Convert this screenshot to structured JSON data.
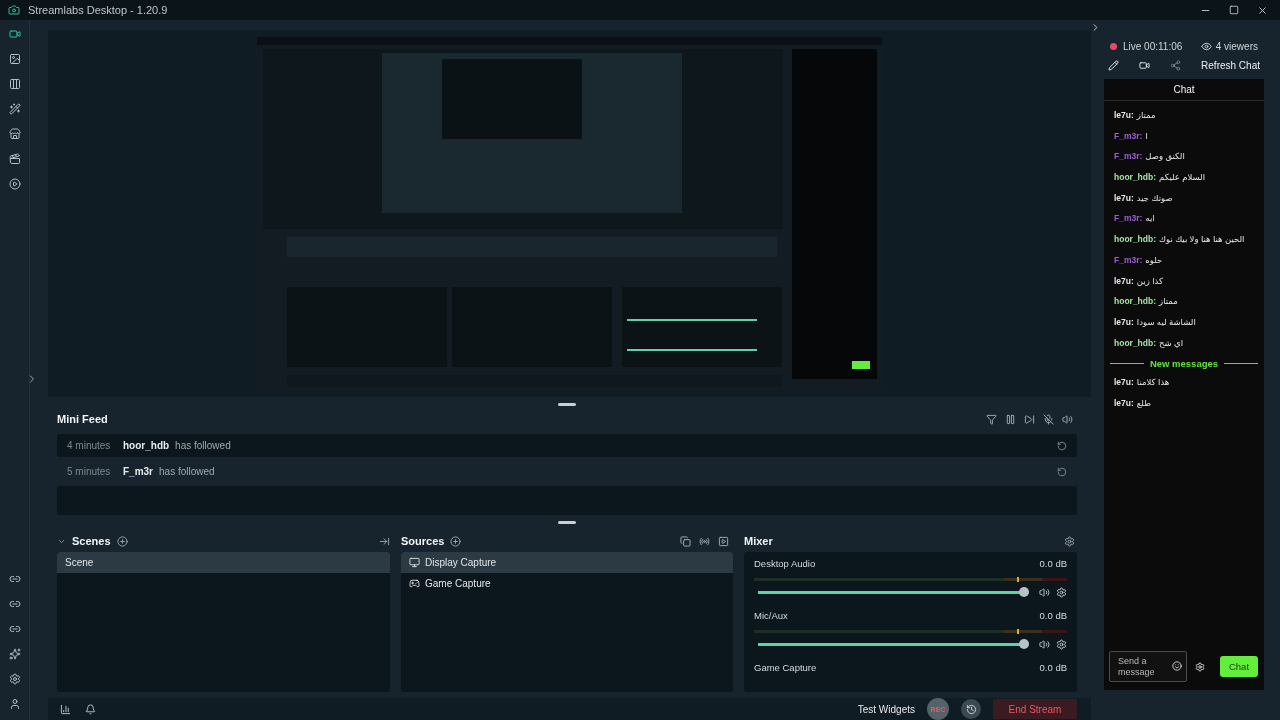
{
  "window": {
    "title": "Streamlabs Desktop - 1.20.9"
  },
  "nav": [
    {
      "selected": true
    },
    {
      "selected": false
    },
    {
      "selected": false
    },
    {
      "selected": false
    },
    {
      "selected": false
    },
    {
      "selected": false
    },
    {
      "selected": false
    }
  ],
  "mini_feed": {
    "title": "Mini Feed",
    "events": [
      {
        "time": "4 minutes",
        "user": "hoor_hdb",
        "action": "has followed"
      },
      {
        "time": "5 minutes",
        "user": "F_m3r",
        "action": "has followed"
      }
    ]
  },
  "scenes": {
    "title": "Scenes",
    "items": [
      {
        "name": "Scene",
        "selected": true
      }
    ]
  },
  "sources": {
    "title": "Sources",
    "items": [
      {
        "name": "Display Capture",
        "kind": "display",
        "selected": true
      },
      {
        "name": "Game Capture",
        "kind": "game",
        "selected": false
      }
    ]
  },
  "mixer": {
    "title": "Mixer",
    "channels": [
      {
        "name": "Desktop Audio",
        "reading": "0.0 dB",
        "level": 0.98
      },
      {
        "name": "Mic/Aux",
        "reading": "0.0 dB",
        "level": 0.98
      },
      {
        "name": "Game Capture",
        "reading": "0.0 dB"
      }
    ]
  },
  "footer": {
    "test_widgets": "Test Widgets",
    "rec": "REC",
    "end_stream": "End Stream"
  },
  "stream": {
    "status": "Live 00:11:06",
    "viewers": "4 viewers",
    "refresh": "Refresh Chat"
  },
  "chat": {
    "title": "Chat",
    "messages": [
      {
        "kind": "message",
        "user": "le7u:",
        "text": "ممتاز",
        "color": "#e8e8e8"
      },
      {
        "kind": "message",
        "user": "F_m3r:",
        "text": "ا",
        "color": "#9a5fd8"
      },
      {
        "kind": "message",
        "user": "F_m3r:",
        "text": "الكنق وصل",
        "color": "#9a5fd8"
      },
      {
        "kind": "message",
        "user": "hoor_hdb:",
        "text": "السلام عليكم",
        "color": "#a3e3a3"
      },
      {
        "kind": "message",
        "user": "le7u:",
        "text": "صوتك جيد",
        "color": "#e8e8e8"
      },
      {
        "kind": "message",
        "user": "F_m3r:",
        "text": "ايه",
        "color": "#9a5fd8"
      },
      {
        "kind": "message",
        "user": "hoor_hdb:",
        "text": "الحين هنا هنا ولا بيك نوك",
        "color": "#a3e3a3"
      },
      {
        "kind": "message",
        "user": "F_m3r:",
        "text": "حلوه",
        "color": "#9a5fd8"
      },
      {
        "kind": "message",
        "user": "le7u:",
        "text": "كذا زين",
        "color": "#e8e8e8"
      },
      {
        "kind": "message",
        "user": "hoor_hdb:",
        "text": "ممتاز",
        "color": "#a3e3a3"
      },
      {
        "kind": "message",
        "user": "le7u:",
        "text": "الشاشة ليه سودا",
        "color": "#e8e8e8"
      },
      {
        "kind": "message",
        "user": "hoor_hdb:",
        "text": "اي شح",
        "color": "#a3e3a3"
      },
      {
        "kind": "divider",
        "text": "New messages"
      },
      {
        "kind": "message",
        "user": "le7u:",
        "text": "هذا كلامنا",
        "color": "#e8e8e8"
      },
      {
        "kind": "message",
        "user": "le7u:",
        "text": "طلع",
        "color": "#e8e8e8"
      }
    ]
  },
  "composer": {
    "placeholder": "Send a message",
    "button": "Chat"
  }
}
